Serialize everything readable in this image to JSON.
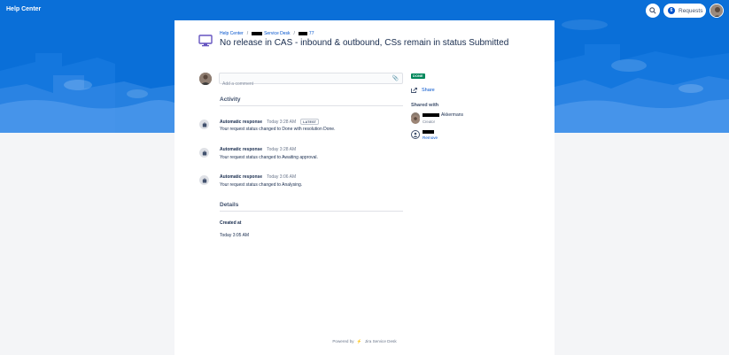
{
  "topbar": {
    "brand": "Help Center",
    "requests_label": "Requests",
    "requests_count": "6"
  },
  "breadcrumb": {
    "home": "Help Center",
    "project": "Service Desk",
    "issue": "77"
  },
  "request": {
    "title": "No release in CAS - inbound & outbound, CSs remain in status Submitted",
    "status": "DONE"
  },
  "comment": {
    "placeholder": "Add a comment"
  },
  "activity": {
    "heading": "Activity",
    "items": [
      {
        "author": "Automatic response",
        "time": "Today 3:28 AM",
        "badge": "LATEST",
        "text": "Your request status changed to Done with resolution Done."
      },
      {
        "author": "Automatic response",
        "time": "Today 3:28 AM",
        "text": "Your request status changed to Awaiting approval."
      },
      {
        "author": "Automatic response",
        "time": "Today 3:06 AM",
        "text": "Your request status changed to Analysing."
      }
    ]
  },
  "details": {
    "heading": "Details",
    "created_label": "Created at",
    "created_value": "Today 3:05 AM"
  },
  "sidebar": {
    "share_label": "Share",
    "shared_with_heading": "Shared with",
    "creator_name": "Akkermans",
    "creator_role": "Creator",
    "remove_label": "Remove"
  },
  "footer": {
    "powered_by": "Powered by",
    "product": "Jira Service Desk"
  },
  "colors": {
    "hero": "#0a6fd8",
    "link": "#0052cc",
    "done": "#00875a"
  }
}
